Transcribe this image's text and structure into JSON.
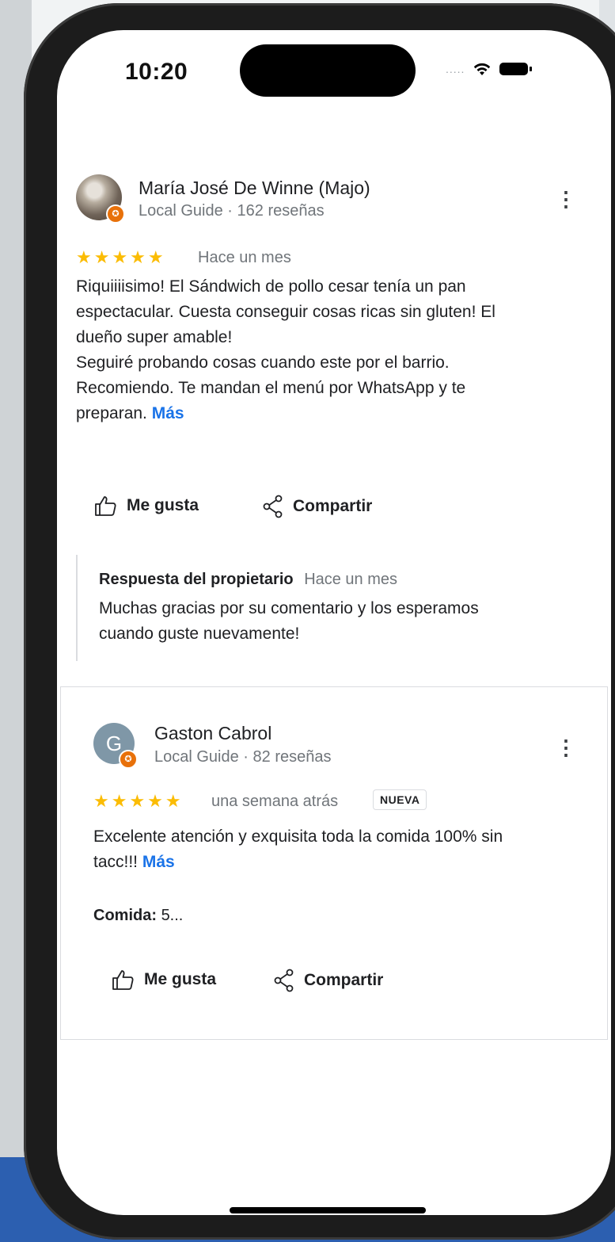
{
  "status_bar": {
    "time": "10:20",
    "signal_text": "....."
  },
  "reviews": [
    {
      "author": "María José De Winne (Majo)",
      "meta": "Local Guide · 162 reseñas",
      "stars": "★★★★★",
      "rating": 5,
      "when": "Hace un mes",
      "text_lines": [
        "Riquiiiisimo! El Sándwich de pollo cesar tenía un pan",
        "espectacular. Cuesta conseguir cosas ricas sin gluten! El",
        "dueño super amable!",
        "Seguiré probando cosas cuando este por el barrio.",
        "Recomiendo. Te mandan el menú por WhatsApp y te"
      ],
      "text_last": "preparan.",
      "more": "Más",
      "like": "Me gusta",
      "share": "Compartir",
      "owner_reply": {
        "title": "Respuesta del propietario",
        "when": "Hace un mes",
        "line1": "Muchas gracias por su comentario y los esperamos",
        "line2": "cuando guste nuevamente!"
      }
    },
    {
      "author": "Gaston Cabrol",
      "avatar_letter": "G",
      "meta": "Local Guide · 82 reseñas",
      "stars": "★★★★★",
      "rating": 5,
      "when": "una semana atrás",
      "badge": "NUEVA",
      "text_line1": "Excelente atención y exquisita toda la comida 100% sin",
      "text_last": "tacc!!!",
      "more": "Más",
      "food_label": "Comida:",
      "food_value": "5...",
      "like": "Me gusta",
      "share": "Compartir"
    }
  ],
  "colors": {
    "star": "#fbbc04",
    "link": "#1a73e8",
    "guide_badge": "#e8710a"
  }
}
